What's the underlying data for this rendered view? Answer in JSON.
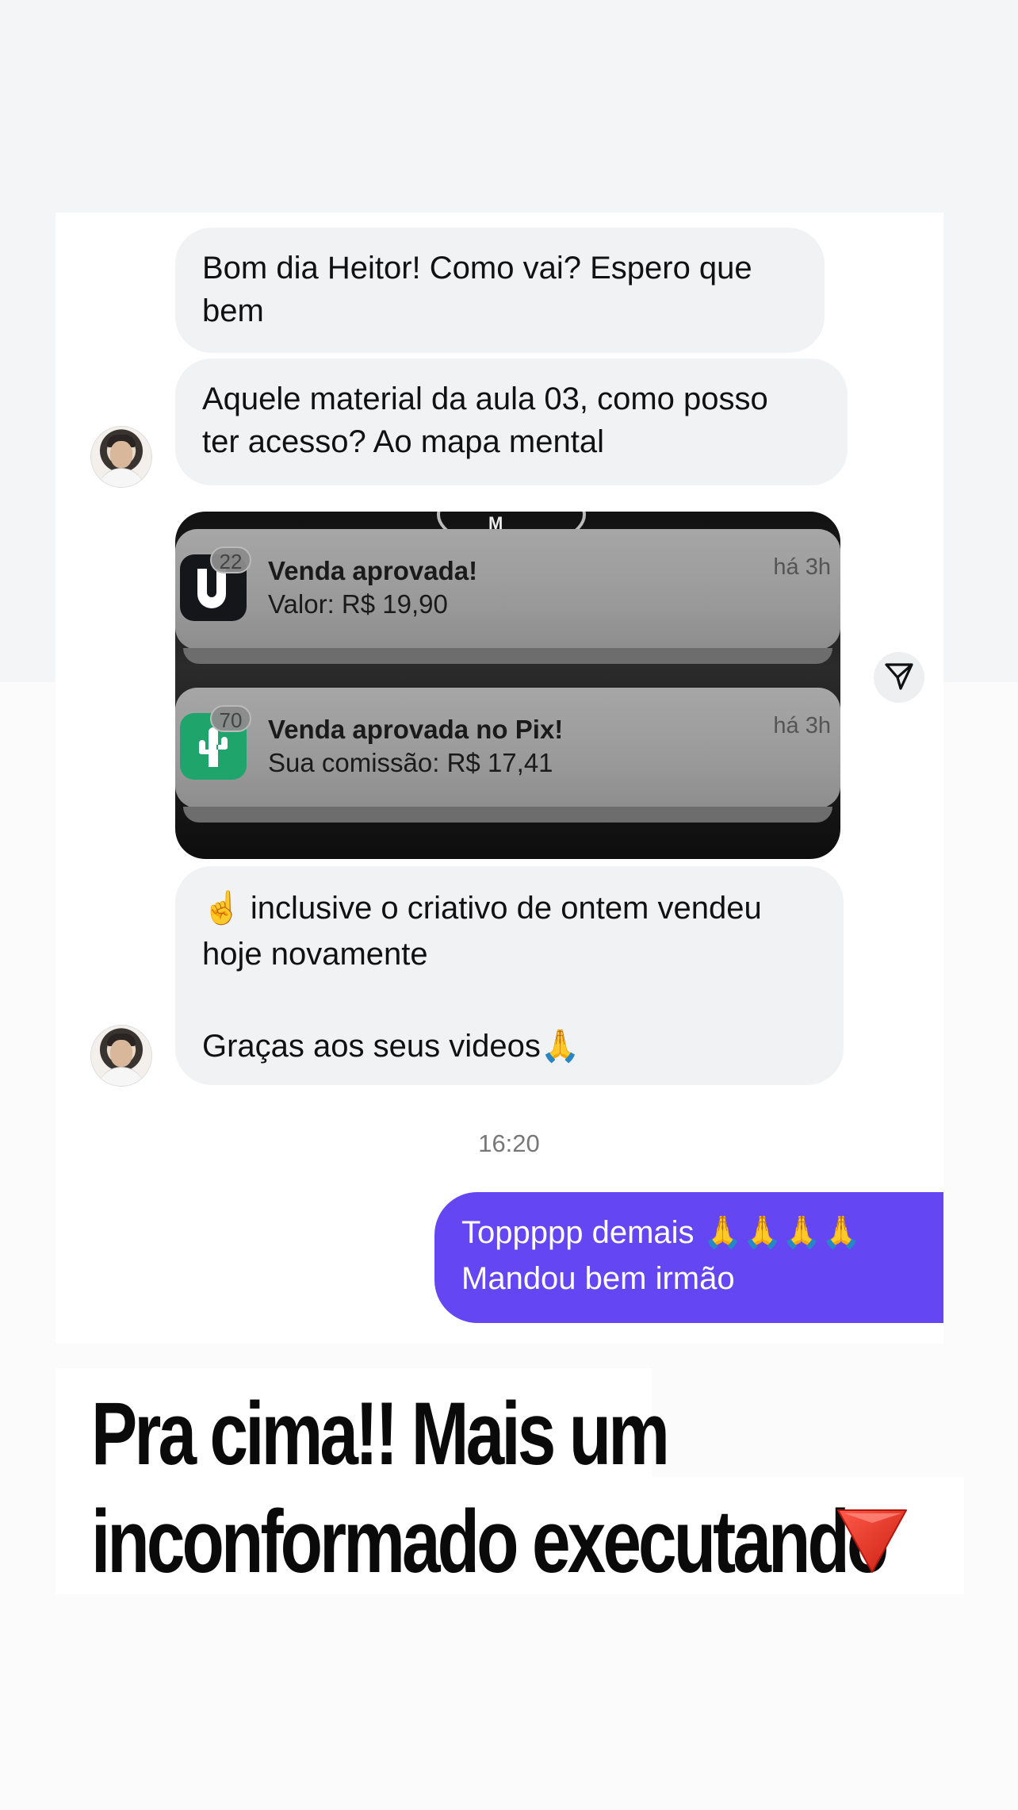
{
  "messages": {
    "incoming": [
      {
        "lines": [
          "Bom dia Heitor! Como vai? Espero que",
          "bem"
        ]
      },
      {
        "lines": [
          "Aquele material da aula 03, como posso",
          "ter acesso? Ao mapa mental"
        ]
      },
      {
        "lines": [
          "☝️ inclusive o criativo de ontem vendeu",
          "hoje novamente",
          "",
          "Graças aos seus videos🙏"
        ]
      }
    ],
    "image_attachment": {
      "notifications": [
        {
          "badge": "22",
          "title": "Venda aprovada!",
          "body": "Valor: R$ 19,90",
          "time": "há 3h",
          "icon": "sales-app-logo-icon",
          "icon_color": "#15161a"
        },
        {
          "badge": "70",
          "title": "Venda aprovada no Pix!",
          "body": "Sua comissão: R$ 17,41",
          "time": "há 3h",
          "icon": "cactus-app-logo-icon",
          "icon_color": "#1fa46b"
        }
      ]
    },
    "timestamp": "16:20",
    "outgoing": {
      "lines": [
        "Toppppp demais 🙏🙏🙏🙏",
        "Mandou bem irmão"
      ],
      "color": "#6446f2"
    }
  },
  "caption": {
    "lines": [
      "Pra cima!! Mais um",
      "inconformado executando"
    ],
    "emoji": "down-red-triangle"
  }
}
